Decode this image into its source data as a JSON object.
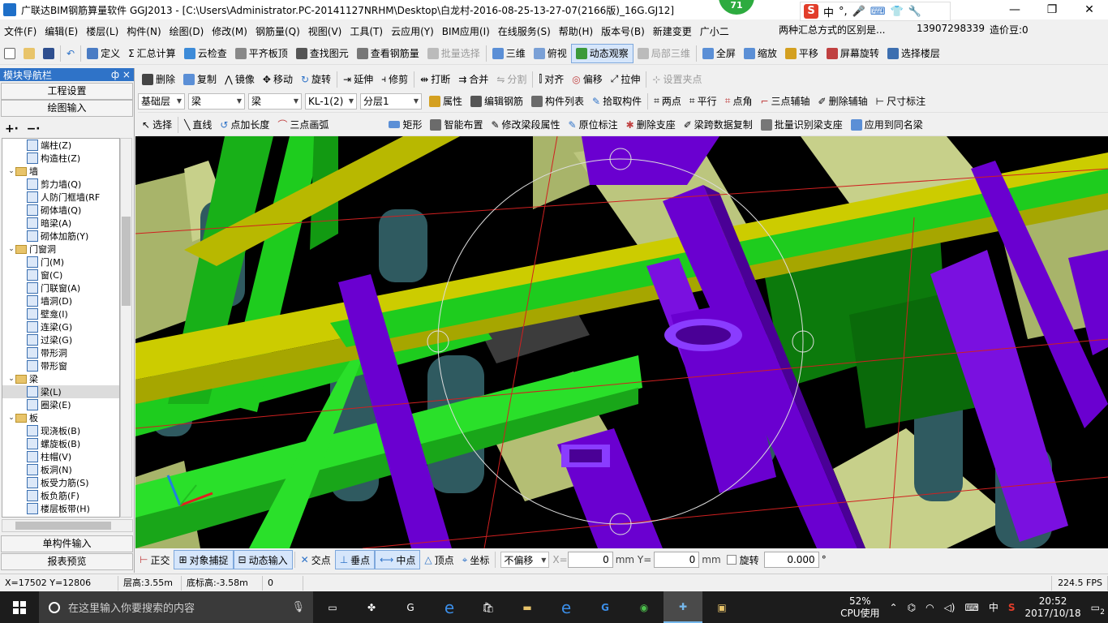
{
  "title": "广联达BIM钢筋算量软件 GGJ2013 - [C:\\Users\\Administrator.PC-20141127NRHM\\Desktop\\白龙村-2016-08-25-13-27-07(2166版)_16G.GJ12]",
  "green_badge": "71",
  "ime": {
    "zh": "中",
    "dot": "°,"
  },
  "menu": [
    "文件(F)",
    "编辑(E)",
    "楼层(L)",
    "构件(N)",
    "绘图(D)",
    "修改(M)",
    "钢筋量(Q)",
    "视图(V)",
    "工具(T)",
    "云应用(Y)",
    "BIM应用(I)",
    "在线服务(S)",
    "帮助(H)",
    "版本号(B)",
    "新建变更",
    "广小二"
  ],
  "tip_text": "两种汇总方式的区别是...",
  "phone": "13907298339",
  "price": "造价豆:0",
  "toolbar1": [
    "定义",
    "汇总计算",
    "云检查",
    "平齐板顶",
    "查找图元",
    "查看钢筋量",
    "批量选择",
    "三维",
    "俯视",
    "动态观察",
    "局部三维",
    "全屏",
    "缩放",
    "平移",
    "屏幕旋转",
    "选择楼层"
  ],
  "toolbar2": [
    "删除",
    "复制",
    "镜像",
    "移动",
    "旋转",
    "延伸",
    "修剪",
    "打断",
    "合并",
    "分割",
    "对齐",
    "偏移",
    "拉伸",
    "设置夹点"
  ],
  "toolbar3": {
    "floor": "基础层",
    "type1": "梁",
    "type2": "梁",
    "member": "KL-1(2)",
    "layer": "分层1",
    "buttons": [
      "属性",
      "编辑钢筋",
      "构件列表",
      "拾取构件",
      "两点",
      "平行",
      "点角",
      "三点辅轴",
      "删除辅轴",
      "尺寸标注"
    ]
  },
  "toolbar4": [
    "选择",
    "直线",
    "点加长度",
    "三点画弧",
    "矩形",
    "智能布置",
    "修改梁段属性",
    "原位标注",
    "删除支座",
    "梁跨数据复制",
    "批量识别梁支座",
    "应用到同名梁"
  ],
  "panel": {
    "header": "模块导航栏",
    "pin": "ф ×",
    "btn_settings": "工程设置",
    "btn_draw": "绘图输入",
    "btn_single": "单构件输入",
    "btn_report": "报表预览"
  },
  "tree": [
    {
      "label": "端柱(Z)",
      "level": 2
    },
    {
      "label": "构造柱(Z)",
      "level": 2
    },
    {
      "label": "墙",
      "level": 1,
      "folder": true
    },
    {
      "label": "剪力墙(Q)",
      "level": 2
    },
    {
      "label": "人防门框墙(RF",
      "level": 2
    },
    {
      "label": "砌体墙(Q)",
      "level": 2
    },
    {
      "label": "暗梁(A)",
      "level": 2
    },
    {
      "label": "砌体加筋(Y)",
      "level": 2
    },
    {
      "label": "门窗洞",
      "level": 1,
      "folder": true
    },
    {
      "label": "门(M)",
      "level": 2
    },
    {
      "label": "窗(C)",
      "level": 2
    },
    {
      "label": "门联窗(A)",
      "level": 2
    },
    {
      "label": "墙洞(D)",
      "level": 2
    },
    {
      "label": "壁龛(I)",
      "level": 2
    },
    {
      "label": "连梁(G)",
      "level": 2
    },
    {
      "label": "过梁(G)",
      "level": 2
    },
    {
      "label": "带形洞",
      "level": 2
    },
    {
      "label": "带形窗",
      "level": 2
    },
    {
      "label": "梁",
      "level": 1,
      "folder": true
    },
    {
      "label": "梁(L)",
      "level": 2,
      "selected": true
    },
    {
      "label": "圈梁(E)",
      "level": 2
    },
    {
      "label": "板",
      "level": 1,
      "folder": true
    },
    {
      "label": "现浇板(B)",
      "level": 2
    },
    {
      "label": "螺旋板(B)",
      "level": 2
    },
    {
      "label": "柱帽(V)",
      "level": 2
    },
    {
      "label": "板洞(N)",
      "level": 2
    },
    {
      "label": "板受力筋(S)",
      "level": 2
    },
    {
      "label": "板负筋(F)",
      "level": 2
    },
    {
      "label": "楼层板带(H)",
      "level": 2
    }
  ],
  "snap": {
    "buttons": [
      "正交",
      "对象捕捉",
      "动态输入",
      "交点",
      "垂点",
      "中点",
      "顶点",
      "坐标"
    ],
    "offset": "不偏移",
    "x_label": "X=",
    "x_value": "0",
    "y_label": "mm Y=",
    "y_value": "0",
    "mm": "mm",
    "rotate": "旋转",
    "rotate_value": "0.000",
    "deg": "°"
  },
  "status": {
    "coords": "X=17502 Y=12806",
    "floor_height": "层高:3.55m",
    "bottom_height": "底标高:-3.58m",
    "zero": "0",
    "fps": "224.5 FPS"
  },
  "taskbar": {
    "search_placeholder": "在这里输入你要搜索的内容",
    "cpu": "52%",
    "cpu_label": "CPU使用",
    "lang": "中",
    "time": "20:52",
    "date": "2017/10/18",
    "notif": "2"
  },
  "colors": {
    "accent_blue": "#2f73c8",
    "beam_yellow": "#cccc00",
    "beam_green": "#1ecc1e",
    "column_purple": "#6a00d0",
    "slab_olive": "#a8b46a",
    "pile_teal": "#2f5a60"
  }
}
